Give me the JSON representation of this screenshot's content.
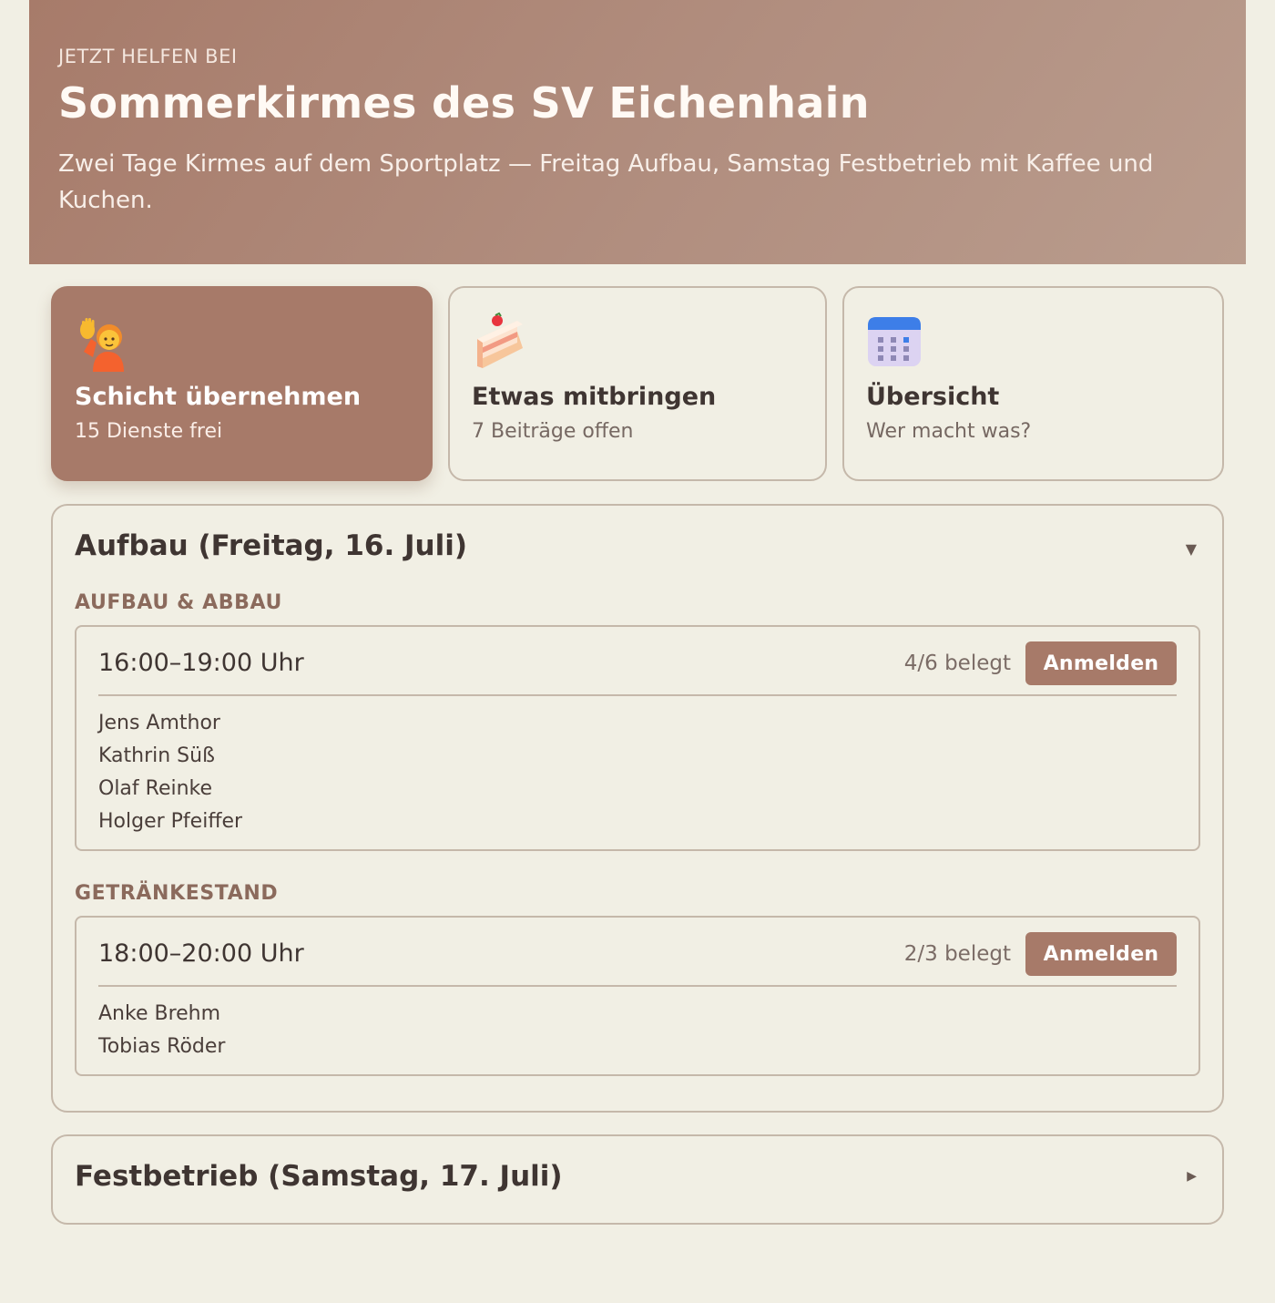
{
  "hero": {
    "eyebrow": "JETZT HELFEN BEI",
    "title": "Sommerkirmes des SV Eichenhain",
    "description": "Zwei Tage Kirmes auf dem Sportplatz — Freitag Aufbau, Samstag Festbetrieb mit Kaffee und Kuchen."
  },
  "cards": [
    {
      "icon": "raising-hand-person-icon",
      "title": "Schicht übernehmen",
      "sub": "15 Dienste frei",
      "active": true
    },
    {
      "icon": "cake-slice-icon",
      "title": "Etwas mitbringen",
      "sub": "7 Beiträge offen",
      "active": false
    },
    {
      "icon": "calendar-icon",
      "title": "Übersicht",
      "sub": "Wer macht was?",
      "active": false
    }
  ],
  "sections": [
    {
      "title": "Aufbau (Freitag, 16. Juli)",
      "arrow": "▼",
      "expanded": true,
      "groups": [
        {
          "label": "AUFBAU & ABBAU",
          "slot": {
            "time": "16:00–19:00 Uhr",
            "count": "4/6 belegt",
            "button": "Anmelden",
            "names": [
              "Jens Amthor",
              "Kathrin Süß",
              "Olaf Reinke",
              "Holger Pfeiffer"
            ]
          }
        },
        {
          "label": "GETRÄNKESTAND",
          "slot": {
            "time": "18:00–20:00 Uhr",
            "count": "2/3 belegt",
            "button": "Anmelden",
            "names": [
              "Anke Brehm",
              "Tobias Röder"
            ]
          }
        }
      ]
    },
    {
      "title": "Festbetrieb (Samstag, 17. Juli)",
      "arrow": "▶",
      "expanded": false
    }
  ],
  "colors": {
    "accent": "#a77a69",
    "background": "#f1efe4",
    "border": "#c5b8aa",
    "group_label": "#8b6a5c"
  }
}
